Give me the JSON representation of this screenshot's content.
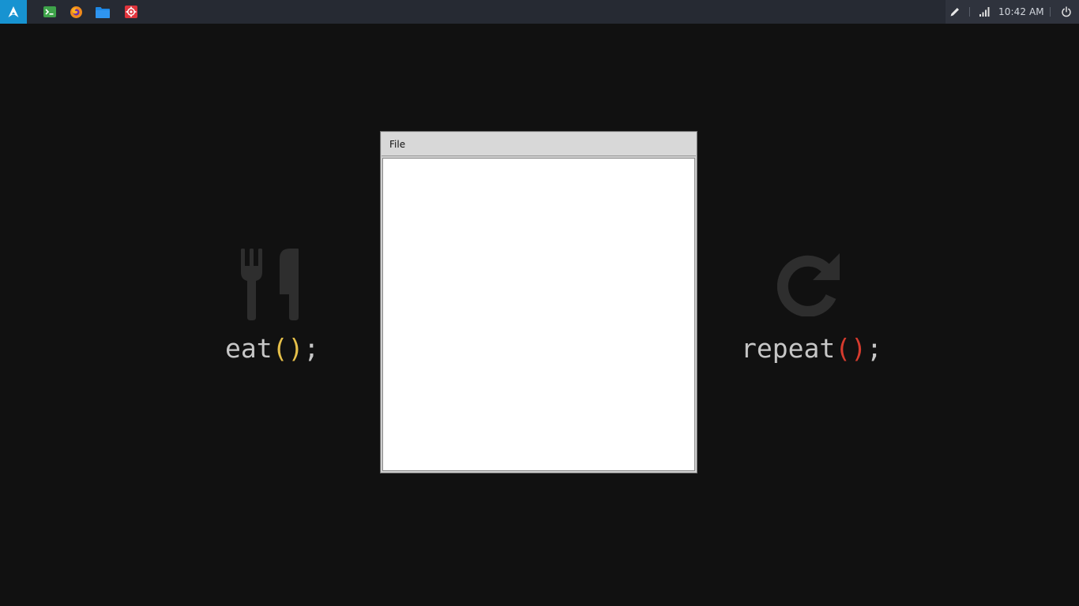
{
  "taskbar": {
    "launcher_icon": "arch-linux-icon",
    "apps": [
      {
        "name": "terminal-icon",
        "color": "#3ea34a"
      },
      {
        "name": "firefox-icon",
        "color": "#f08a1c"
      },
      {
        "name": "folder-icon",
        "color": "#1e88e5"
      },
      {
        "name": "settings-icon",
        "color": "#e0343c"
      }
    ],
    "tray": {
      "pen_icon": "pen-icon",
      "network_icon": "signal-icon",
      "clock": "10:42 AM",
      "power_icon": "power-icon"
    },
    "colors": {
      "bar_bg": "#262a33",
      "launcher_bg": "#1793d1",
      "tray_bg": "#2f333d"
    }
  },
  "wallpaper": {
    "left": {
      "icon": "fork-knife-icon",
      "word": "eat",
      "parens": "()",
      "semicolon": ";"
    },
    "right": {
      "icon": "redo-arrow-icon",
      "word": "repeat",
      "parens": "()",
      "semicolon": ";"
    },
    "colors": {
      "background": "#111111",
      "text": "#c6c6c6",
      "eat_accent": "#e6c04a",
      "repeat_accent": "#d63b2e",
      "icon": "#2e2e2e"
    }
  },
  "window": {
    "menu": {
      "file_label": "File"
    }
  }
}
